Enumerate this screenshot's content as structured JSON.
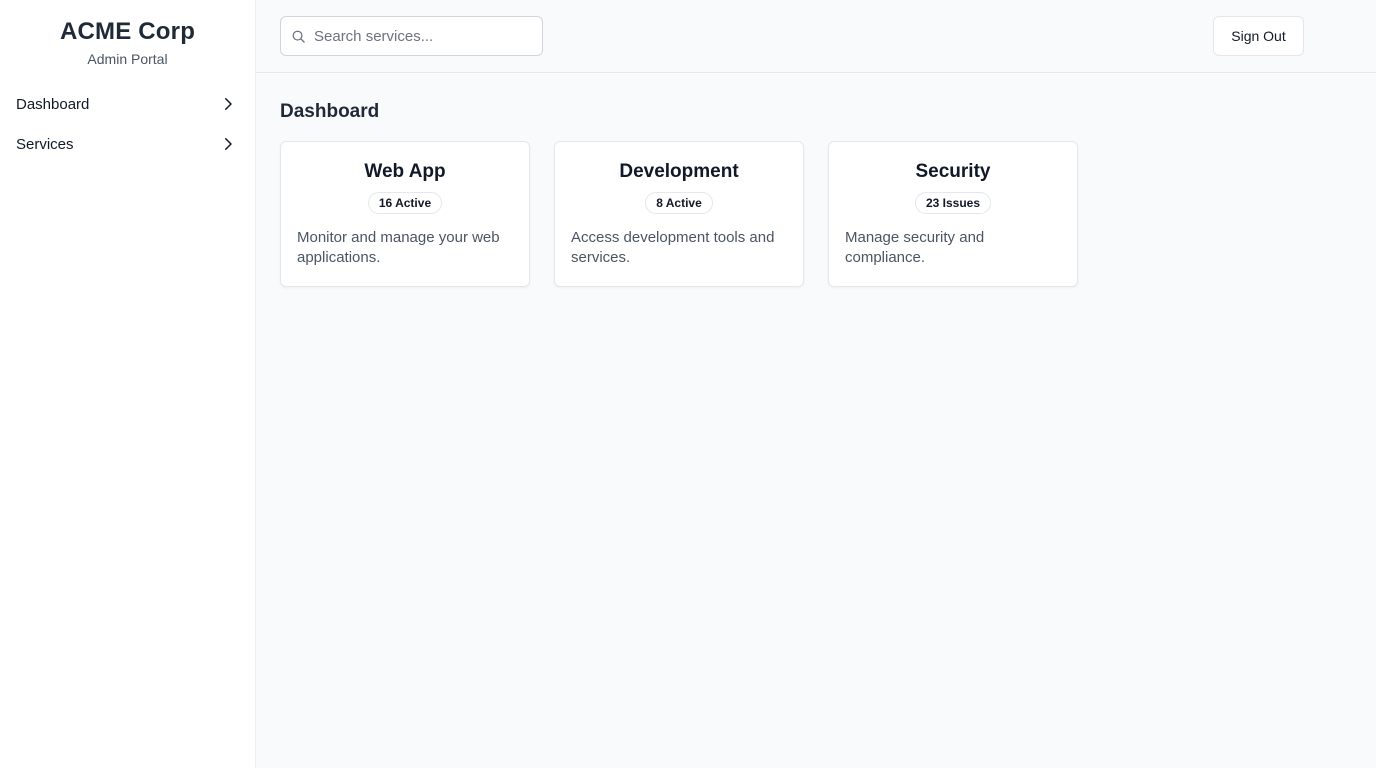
{
  "brand": {
    "title": "ACME Corp",
    "subtitle": "Admin Portal"
  },
  "sidebar": {
    "items": [
      {
        "label": "Dashboard",
        "icon": "chevron-right-icon"
      },
      {
        "label": "Services",
        "icon": "chevron-right-icon"
      }
    ]
  },
  "header": {
    "search": {
      "placeholder": "Search services...",
      "value": "",
      "icon": "search-icon"
    },
    "signout_label": "Sign Out"
  },
  "main": {
    "title": "Dashboard",
    "cards": [
      {
        "title": "Web App",
        "badge": "16 Active",
        "description": "Monitor and manage your web applications."
      },
      {
        "title": "Development",
        "badge": "8 Active",
        "description": "Access development tools and services."
      },
      {
        "title": "Security",
        "badge": "23 Issues",
        "description": "Manage security and compliance."
      }
    ]
  },
  "colors": {
    "background": "#f9fafb",
    "sidebar": "#ffffff",
    "text": "#111827",
    "muted": "#4b5563",
    "border": "#e5e7eb"
  }
}
